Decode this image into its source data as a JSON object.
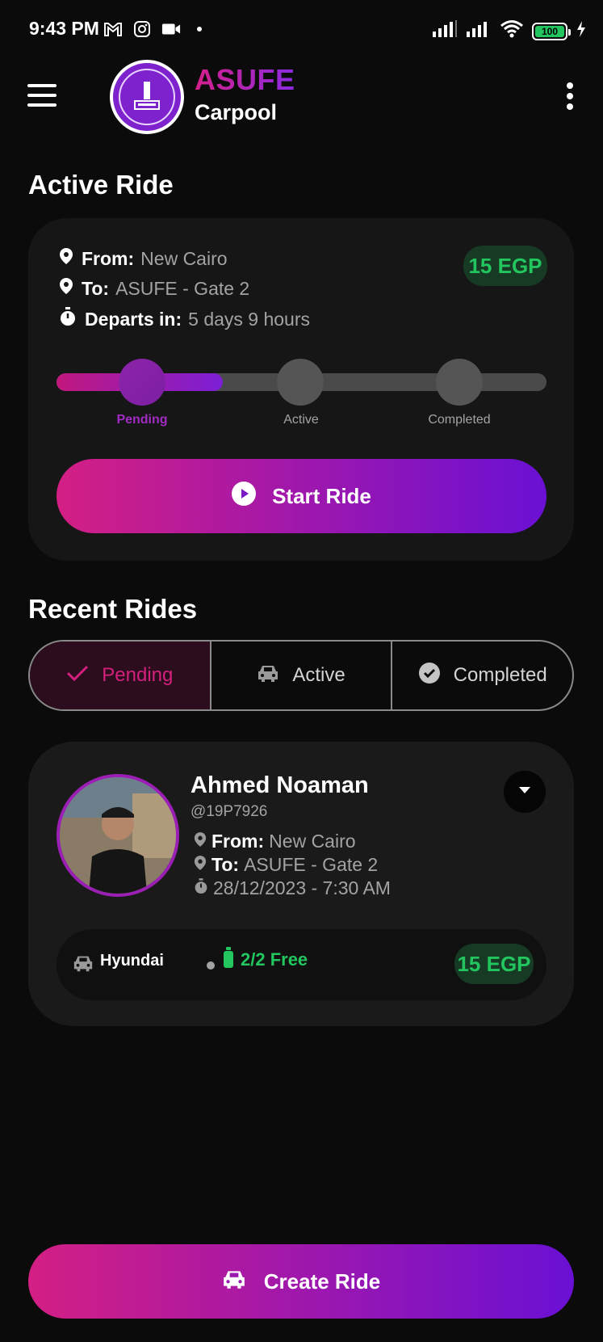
{
  "status_bar": {
    "time": "9:43 PM",
    "battery": "100",
    "icons": [
      "gmail-icon",
      "instagram-icon",
      "video-icon",
      "signal-icon",
      "signal-icon",
      "wifi-icon",
      "battery-icon",
      "charging-icon"
    ]
  },
  "header": {
    "brand_name": "ASUFE",
    "brand_sub": "Carpool"
  },
  "active_ride": {
    "section_title": "Active Ride",
    "from_label": "From:",
    "from_value": "New Cairo",
    "to_label": "To:",
    "to_value": "ASUFE - Gate 2",
    "departs_label": "Departs in:",
    "departs_value": "5 days 9 hours",
    "price": "15 EGP",
    "progress_fraction": 0.34,
    "steps": [
      "Pending",
      "Active",
      "Completed"
    ],
    "current_step": "Pending",
    "start_button": "Start Ride"
  },
  "recent_rides": {
    "section_title": "Recent Rides",
    "tabs": [
      {
        "label": "Pending",
        "icon": "check-icon",
        "selected": true
      },
      {
        "label": "Active",
        "icon": "car-icon",
        "selected": false
      },
      {
        "label": "Completed",
        "icon": "check-circle-icon",
        "selected": false
      }
    ],
    "rides": [
      {
        "driver_name": "Ahmed Noaman",
        "driver_handle": "@19P7926",
        "from_label": "From:",
        "from_value": "New Cairo",
        "to_label": "To:",
        "to_value": "ASUFE - Gate 2",
        "datetime": "28/12/2023 - 7:30 AM",
        "car_model": "Hyundai",
        "seats": "2/2 Free",
        "price": "15 EGP"
      }
    ]
  },
  "create_button": "Create Ride",
  "colors": {
    "accent_pink": "#d41f84",
    "accent_purple": "#6a10d4",
    "success_green": "#22c55e",
    "background": "#0b0b0b"
  }
}
